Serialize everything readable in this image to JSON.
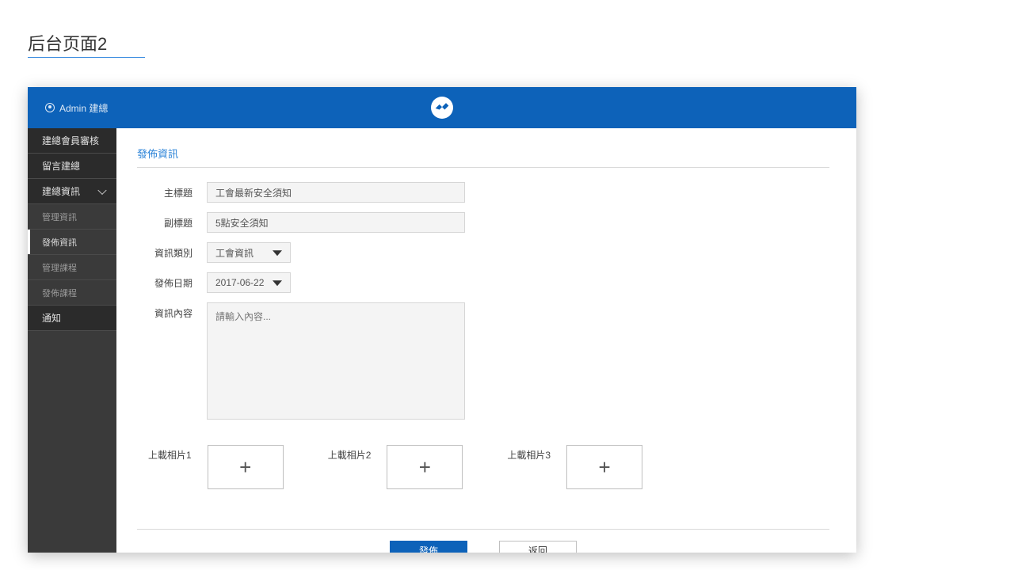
{
  "page": {
    "title": "后台页面2"
  },
  "topbar": {
    "admin_label": "Admin 建總"
  },
  "sidebar": {
    "items": [
      {
        "label": "建總會員審核",
        "type": "main"
      },
      {
        "label": "留言建總",
        "type": "main"
      },
      {
        "label": "建總資訊",
        "type": "main",
        "expand": true
      },
      {
        "label": "管理資訊",
        "type": "sub"
      },
      {
        "label": "發佈資訊",
        "type": "sub",
        "active": true
      },
      {
        "label": "管理課程",
        "type": "sub"
      },
      {
        "label": "發佈課程",
        "type": "sub"
      },
      {
        "label": "通知",
        "type": "main"
      }
    ]
  },
  "content": {
    "section_title": "發佈資訊",
    "form": {
      "main_title_label": "主標題",
      "main_title_value": "工會最新安全須知",
      "subtitle_label": "副標題",
      "subtitle_value": "5點安全須知",
      "category_label": "資訊類別",
      "category_value": "工會資訊",
      "date_label": "發佈日期",
      "date_value": "2017-06-22",
      "body_label": "資訊內容",
      "body_placeholder": "請輸入內容..."
    },
    "uploads": [
      {
        "label": "上載相片1"
      },
      {
        "label": "上載相片2"
      },
      {
        "label": "上載相片3"
      }
    ],
    "buttons": {
      "publish": "發佈",
      "back": "返回"
    }
  }
}
